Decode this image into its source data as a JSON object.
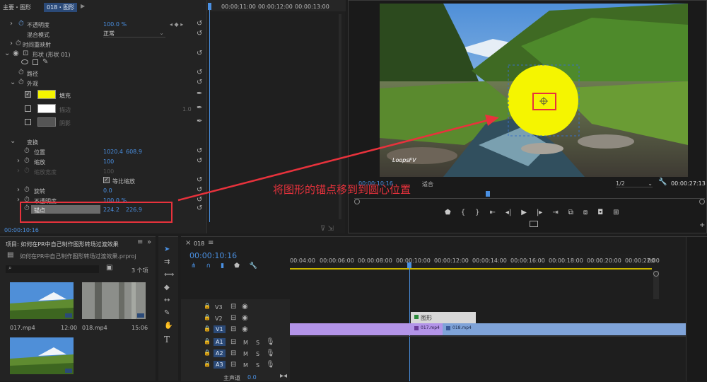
{
  "effect_controls": {
    "header_path": "主要・图形",
    "header_clip": "018・图形",
    "ruler_ticks": [
      "00:00:11:00",
      "00:00:12:00",
      "00:00:13:00"
    ],
    "opacity_label": "不透明度",
    "opacity_value": "100.0 %",
    "blend_mode_label": "混合模式",
    "blend_mode_value": "正常",
    "time_remap_label": "时间重映射",
    "shape_label": "形状 (形状 01)",
    "path_label": "路径",
    "appearance_label": "外观",
    "fill_label": "填充",
    "stroke_label": "描边",
    "stroke_value": "1.0",
    "shadow_label": "阴影",
    "transform_label": "变换",
    "position_label": "位置",
    "position_x": "1020.4",
    "position_y": "608.9",
    "scale_label": "缩放",
    "scale_value": "100",
    "scale_width_label": "缩放宽度",
    "scale_width_value": "100",
    "uniform_scale_label": "等比缩放",
    "rotation_label": "旋转",
    "rotation_value": "0.0",
    "opacity2_label": "不透明度",
    "opacity2_value": "100.0 %",
    "anchor_label": "锚点",
    "anchor_x": "224.2",
    "anchor_y": "226.9",
    "current_time": "00:00:10:16",
    "fill_color": "#f5f500",
    "stroke_color": "#ffffff",
    "shadow_color": "#555555"
  },
  "program_monitor": {
    "timecode": "00:00:10:16",
    "fit_label": "适合",
    "resolution": "1/2",
    "duration": "00:00:27:13",
    "watermark": "LoopsFV",
    "circle_color": "#f5f500"
  },
  "annotation": {
    "text": "将图形的锚点移到到圆心位置",
    "color": "#e8323c"
  },
  "project_panel": {
    "title": "项目: 如何在PR中自己制作图形转场过渡效果",
    "project_file": "如何在PR中自己制作图形转场过渡效果.prproj",
    "item_count": "3 个项",
    "items": [
      {
        "name": "017.mp4",
        "duration": "12:00"
      },
      {
        "name": "018.mp4",
        "duration": "15:06"
      },
      {
        "name": "",
        "duration": ""
      }
    ]
  },
  "timeline": {
    "sequence_name": "018",
    "timecode": "00:00:10:16",
    "ruler": [
      "00:04:00",
      "00:00:06:00",
      "00:00:08:00",
      "00:00:10:00",
      "00:00:12:00",
      "00:00:14:00",
      "00:00:16:00",
      "00:00:18:00",
      "00:00:20:00",
      "00:00:22:00",
      "00"
    ],
    "tracks": [
      "V3",
      "V2",
      "V1",
      "A1",
      "A2",
      "A3"
    ],
    "master_label": "主声道",
    "master_value": "0.0",
    "graphic_clip_label": "图形",
    "clip_017": "017.mp4",
    "clip_018": "018.mp4"
  }
}
